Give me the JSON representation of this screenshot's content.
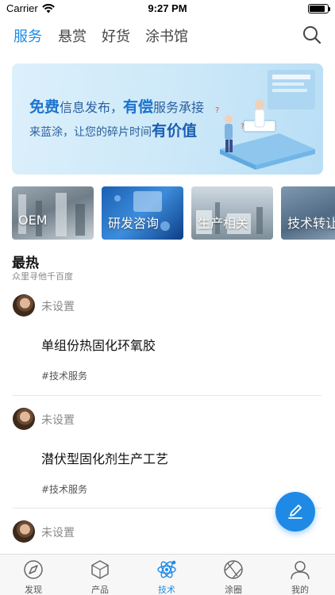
{
  "status_bar": {
    "carrier": "Carrier",
    "time": "9:27 PM",
    "battery_level": 0.85
  },
  "top_tabs": [
    {
      "label": "服务",
      "active": true
    },
    {
      "label": "悬赏",
      "active": false
    },
    {
      "label": "好货",
      "active": false
    },
    {
      "label": "涂书馆",
      "active": false
    }
  ],
  "banner": {
    "line1_strong": "免费",
    "line1_mid": "信息发布，",
    "line1_strong2": "有偿",
    "line1_end": "服务承接",
    "line2_start": "来蓝涂，让您的碎片时间",
    "line2_strong": "有价值"
  },
  "categories": [
    {
      "label": "OEM"
    },
    {
      "label": "研发咨询"
    },
    {
      "label": "生产相关"
    },
    {
      "label": "技术转让"
    }
  ],
  "hot": {
    "title": "最热",
    "subtitle": "众里寻他千百度"
  },
  "feed": [
    {
      "author": "未设置",
      "title": "单组份热固化环氧胶",
      "tag": "#技术服务"
    },
    {
      "author": "未设置",
      "title": "潜伏型固化剂生产工艺",
      "tag": "#技术服务"
    },
    {
      "author": "未设置"
    }
  ],
  "tabbar": [
    {
      "label": "发现",
      "icon": "compass-icon",
      "active": false
    },
    {
      "label": "产品",
      "icon": "hexagon-icon",
      "active": false
    },
    {
      "label": "技术",
      "icon": "atom-icon",
      "active": true
    },
    {
      "label": "涂圈",
      "icon": "aperture-icon",
      "active": false
    },
    {
      "label": "我的",
      "icon": "user-icon",
      "active": false
    }
  ],
  "colors": {
    "accent": "#1e8ae6",
    "text": "#222222",
    "muted": "#888888"
  }
}
